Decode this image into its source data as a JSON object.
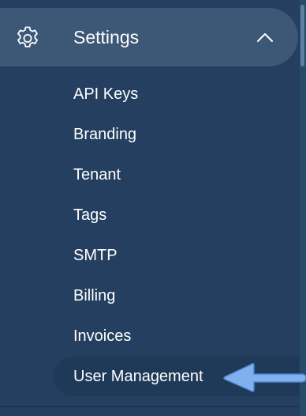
{
  "sidebar": {
    "settings": {
      "label": "Settings",
      "icon": "gear-icon",
      "expanded_icon": "chevron-up-icon"
    },
    "items": [
      {
        "label": "API Keys"
      },
      {
        "label": "Branding"
      },
      {
        "label": "Tenant"
      },
      {
        "label": "Tags"
      },
      {
        "label": "SMTP"
      },
      {
        "label": "Billing"
      },
      {
        "label": "Invoices"
      },
      {
        "label": "User Management"
      }
    ]
  },
  "colors": {
    "sidebar_bg": "#243f5f",
    "header_bg": "#3d5876",
    "highlight_bg": "#1f3a58",
    "text": "#ffffff",
    "arrow": "#7fb1f0"
  }
}
